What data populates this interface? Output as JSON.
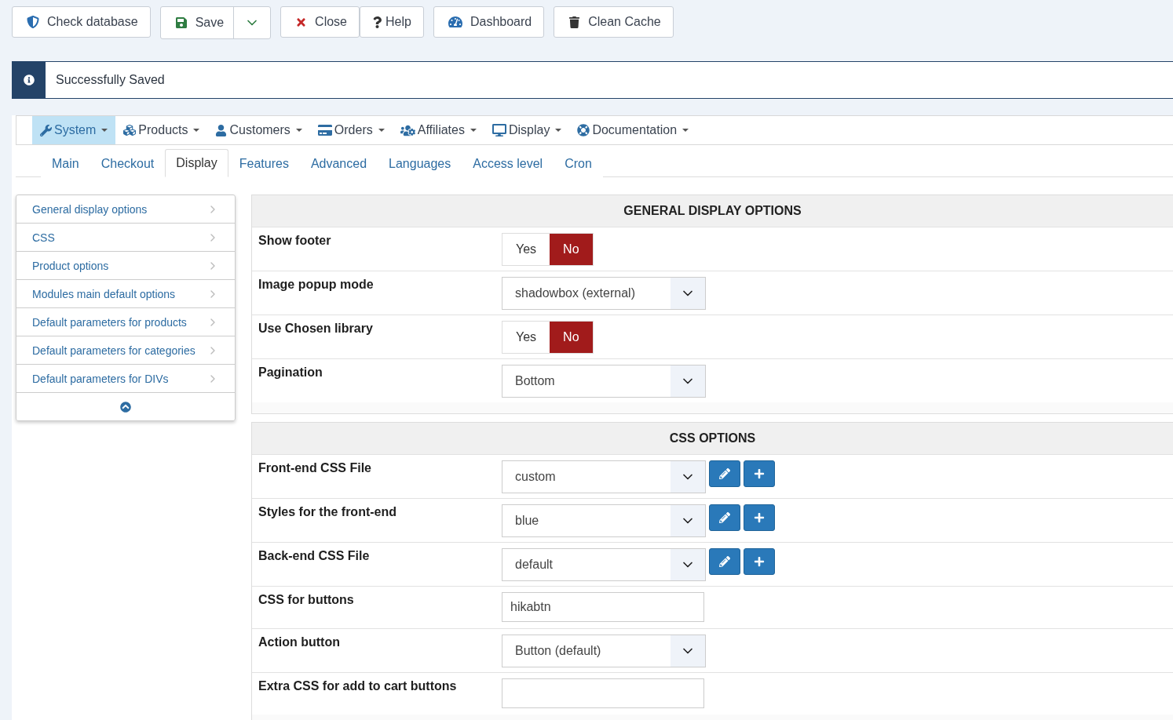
{
  "toolbar": [
    {
      "label": "Check database",
      "split": false
    },
    {
      "label": "Save",
      "split": true
    },
    {
      "label": "Close",
      "split": false
    },
    {
      "label": "Help",
      "split": false
    },
    {
      "label": "Dashboard",
      "split": false
    },
    {
      "label": "Clean Cache",
      "split": false
    }
  ],
  "message": {
    "text": "Successfully Saved"
  },
  "menu": [
    {
      "label": "System",
      "selected": true
    },
    {
      "label": "Products",
      "selected": false
    },
    {
      "label": "Customers",
      "selected": false
    },
    {
      "label": "Orders",
      "selected": false
    },
    {
      "label": "Affiliates",
      "selected": false
    },
    {
      "label": "Display",
      "selected": false
    },
    {
      "label": "Documentation",
      "selected": false
    }
  ],
  "tabs": [
    {
      "label": "Main",
      "selected": false
    },
    {
      "label": "Checkout",
      "selected": false
    },
    {
      "label": "Display",
      "selected": true
    },
    {
      "label": "Features",
      "selected": false
    },
    {
      "label": "Advanced",
      "selected": false
    },
    {
      "label": "Languages",
      "selected": false
    },
    {
      "label": "Access level",
      "selected": false
    },
    {
      "label": "Cron",
      "selected": false
    }
  ],
  "sidebar": {
    "items": [
      {
        "label": "General display options"
      },
      {
        "label": "CSS"
      },
      {
        "label": "Product options"
      },
      {
        "label": "Modules main default options"
      },
      {
        "label": "Default parameters for products"
      },
      {
        "label": "Default parameters for categories"
      },
      {
        "label": "Default parameters for DIVs"
      }
    ]
  },
  "sections": [
    {
      "title": "GENERAL DISPLAY OPTIONS",
      "rows": [
        {
          "label": "Show footer",
          "kind": "toggle",
          "options": [
            {
              "label": "Yes",
              "selected": false
            },
            {
              "label": "No",
              "selected": true
            }
          ]
        },
        {
          "label": "Image popup mode",
          "kind": "select",
          "value": "shadowbox (external)"
        },
        {
          "label": "Use Chosen library",
          "kind": "toggle",
          "options": [
            {
              "label": "Yes",
              "selected": false
            },
            {
              "label": "No",
              "selected": true
            }
          ]
        },
        {
          "label": "Pagination",
          "kind": "select",
          "value": "Bottom"
        }
      ]
    },
    {
      "title": "CSS OPTIONS",
      "rows": [
        {
          "label": "Front-end CSS File",
          "kind": "select_edit",
          "value": "custom"
        },
        {
          "label": "Styles for the front-end",
          "kind": "select_edit",
          "value": "blue"
        },
        {
          "label": "Back-end CSS File",
          "kind": "select_edit",
          "value": "default"
        },
        {
          "label": "CSS for buttons",
          "kind": "text",
          "value": "hikabtn"
        },
        {
          "label": "Action button",
          "kind": "select",
          "value": "Button (default)"
        },
        {
          "label": "Extra CSS for add to cart buttons",
          "kind": "text"
        }
      ]
    }
  ]
}
